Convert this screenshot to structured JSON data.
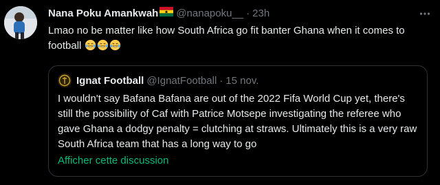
{
  "tweet": {
    "author_name": "Nana Poku Amankwah",
    "flag_icon": "ghana-flag-icon",
    "handle": "@nanapoku__",
    "separator": "·",
    "time": "23h",
    "text": "Lmao no be matter like how South Africa go fit banter Ghana when it comes to football",
    "emojis": [
      "tears-of-joy-emoji",
      "tears-of-joy-emoji",
      "tears-of-joy-emoji"
    ]
  },
  "quoted_tweet": {
    "author_name": "Ignat Football",
    "handle": "@IgnatFootball",
    "separator": "·",
    "time": "15 nov.",
    "text": "I wouldn't say Bafana Bafana are out of the 2022 Fifa World Cup yet, there's still the possibility of Caf with Patrice Motsepe investigating the referee who gave Ghana a dodgy penalty = clutching at straws. Ultimately this is a very raw South Africa team that has a long way to go",
    "show_thread_link": "Afficher cette discussion"
  },
  "colors": {
    "background": "#000000",
    "primary_text": "#e7e9ea",
    "secondary_text": "#71767b",
    "border": "#2f3336",
    "link_accent": "#00ba7c"
  }
}
